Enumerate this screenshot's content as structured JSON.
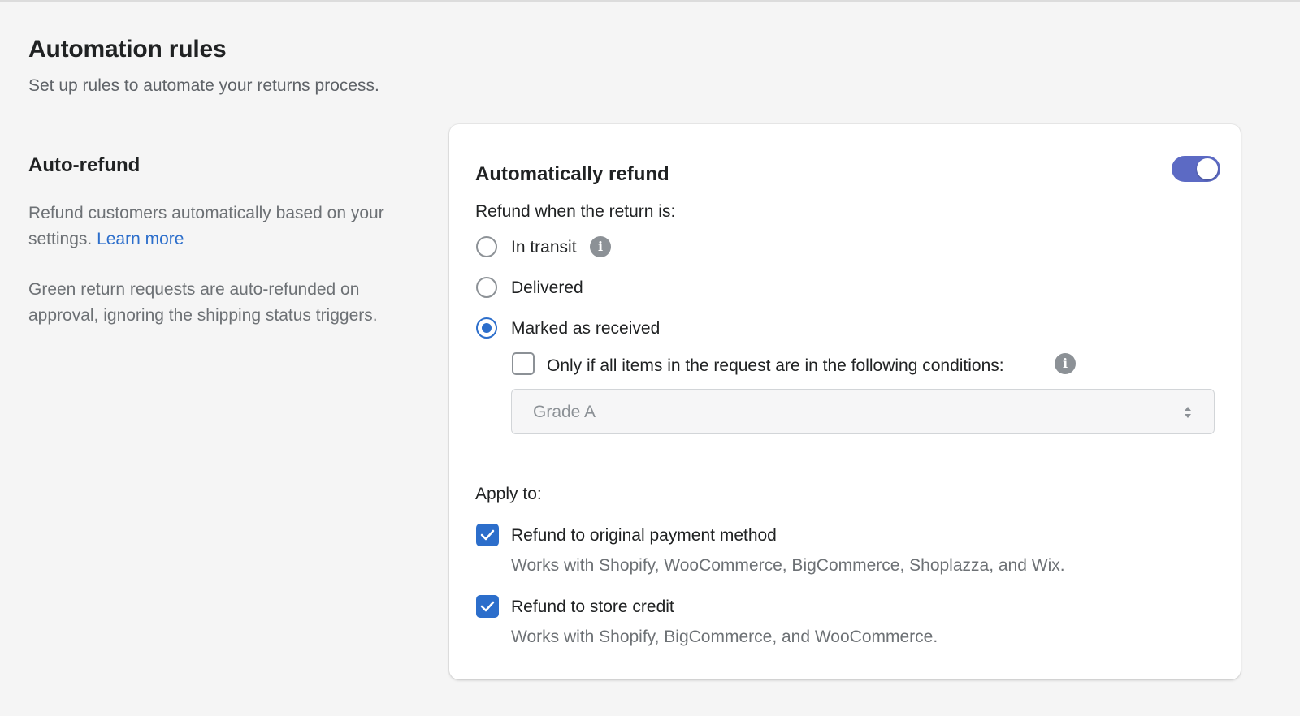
{
  "page": {
    "title": "Automation rules",
    "subtitle": "Set up rules to automate your returns process."
  },
  "section": {
    "title": "Auto-refund",
    "description": "Refund customers automatically based on your settings.",
    "learn_more": "Learn more",
    "note": "Green return requests are auto-refunded on approval, ignoring the shipping status triggers."
  },
  "card": {
    "title": "Automatically refund",
    "toggle_enabled": true,
    "refund_when_label": "Refund when the return is:",
    "options": {
      "in_transit": "In transit",
      "delivered": "Delivered",
      "marked_received": "Marked as received"
    },
    "selected_option": "Marked as received",
    "condition_checkbox_label": "Only if all items in the request are in the following conditions:",
    "condition_checked": false,
    "condition_select_value": "Grade A",
    "apply_to_label": "Apply to:",
    "apply_original": {
      "label": "Refund to original payment method",
      "help": "Works with Shopify, WooCommerce, BigCommerce, Shoplazza, and Wix.",
      "checked": true
    },
    "apply_store_credit": {
      "label": "Refund to store credit",
      "help": "Works with Shopify, BigCommerce, and WooCommerce.",
      "checked": true
    }
  },
  "colors": {
    "accent": "#2c6ecb",
    "toggle": "#5c6ac4",
    "background": "#f5f5f5"
  },
  "icons": [
    "info-icon",
    "checkmark-icon",
    "select-arrows-icon"
  ]
}
